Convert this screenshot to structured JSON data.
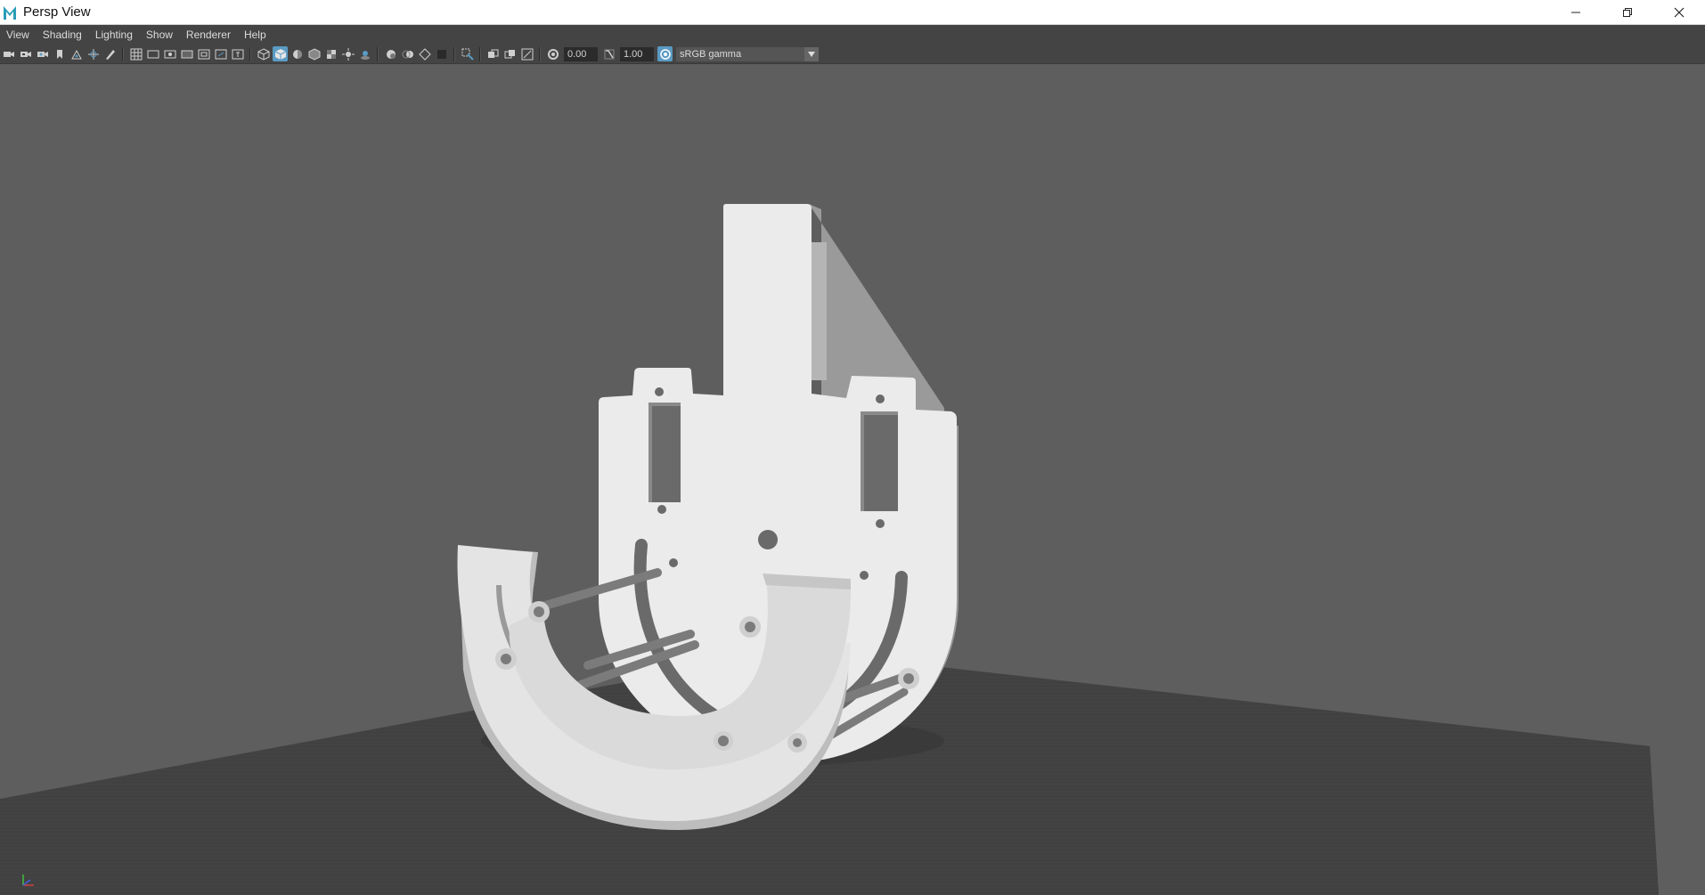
{
  "window": {
    "title": "Persp View",
    "app_icon": "maya-icon",
    "controls": [
      "minimize-icon",
      "restore-icon",
      "close-icon"
    ]
  },
  "menu": {
    "items": [
      {
        "label": "View"
      },
      {
        "label": "Shading"
      },
      {
        "label": "Lighting"
      },
      {
        "label": "Show"
      },
      {
        "label": "Renderer"
      },
      {
        "label": "Help"
      }
    ]
  },
  "toolbar": {
    "exposure_value": "0.00",
    "gamma_value": "1.00",
    "color_space": "sRGB gamma",
    "accent_color": "#5a9bc4"
  },
  "viewport": {
    "background_color": "#5e5e5e",
    "ground_color": "#404040",
    "model_color": "#e8e8e8"
  }
}
